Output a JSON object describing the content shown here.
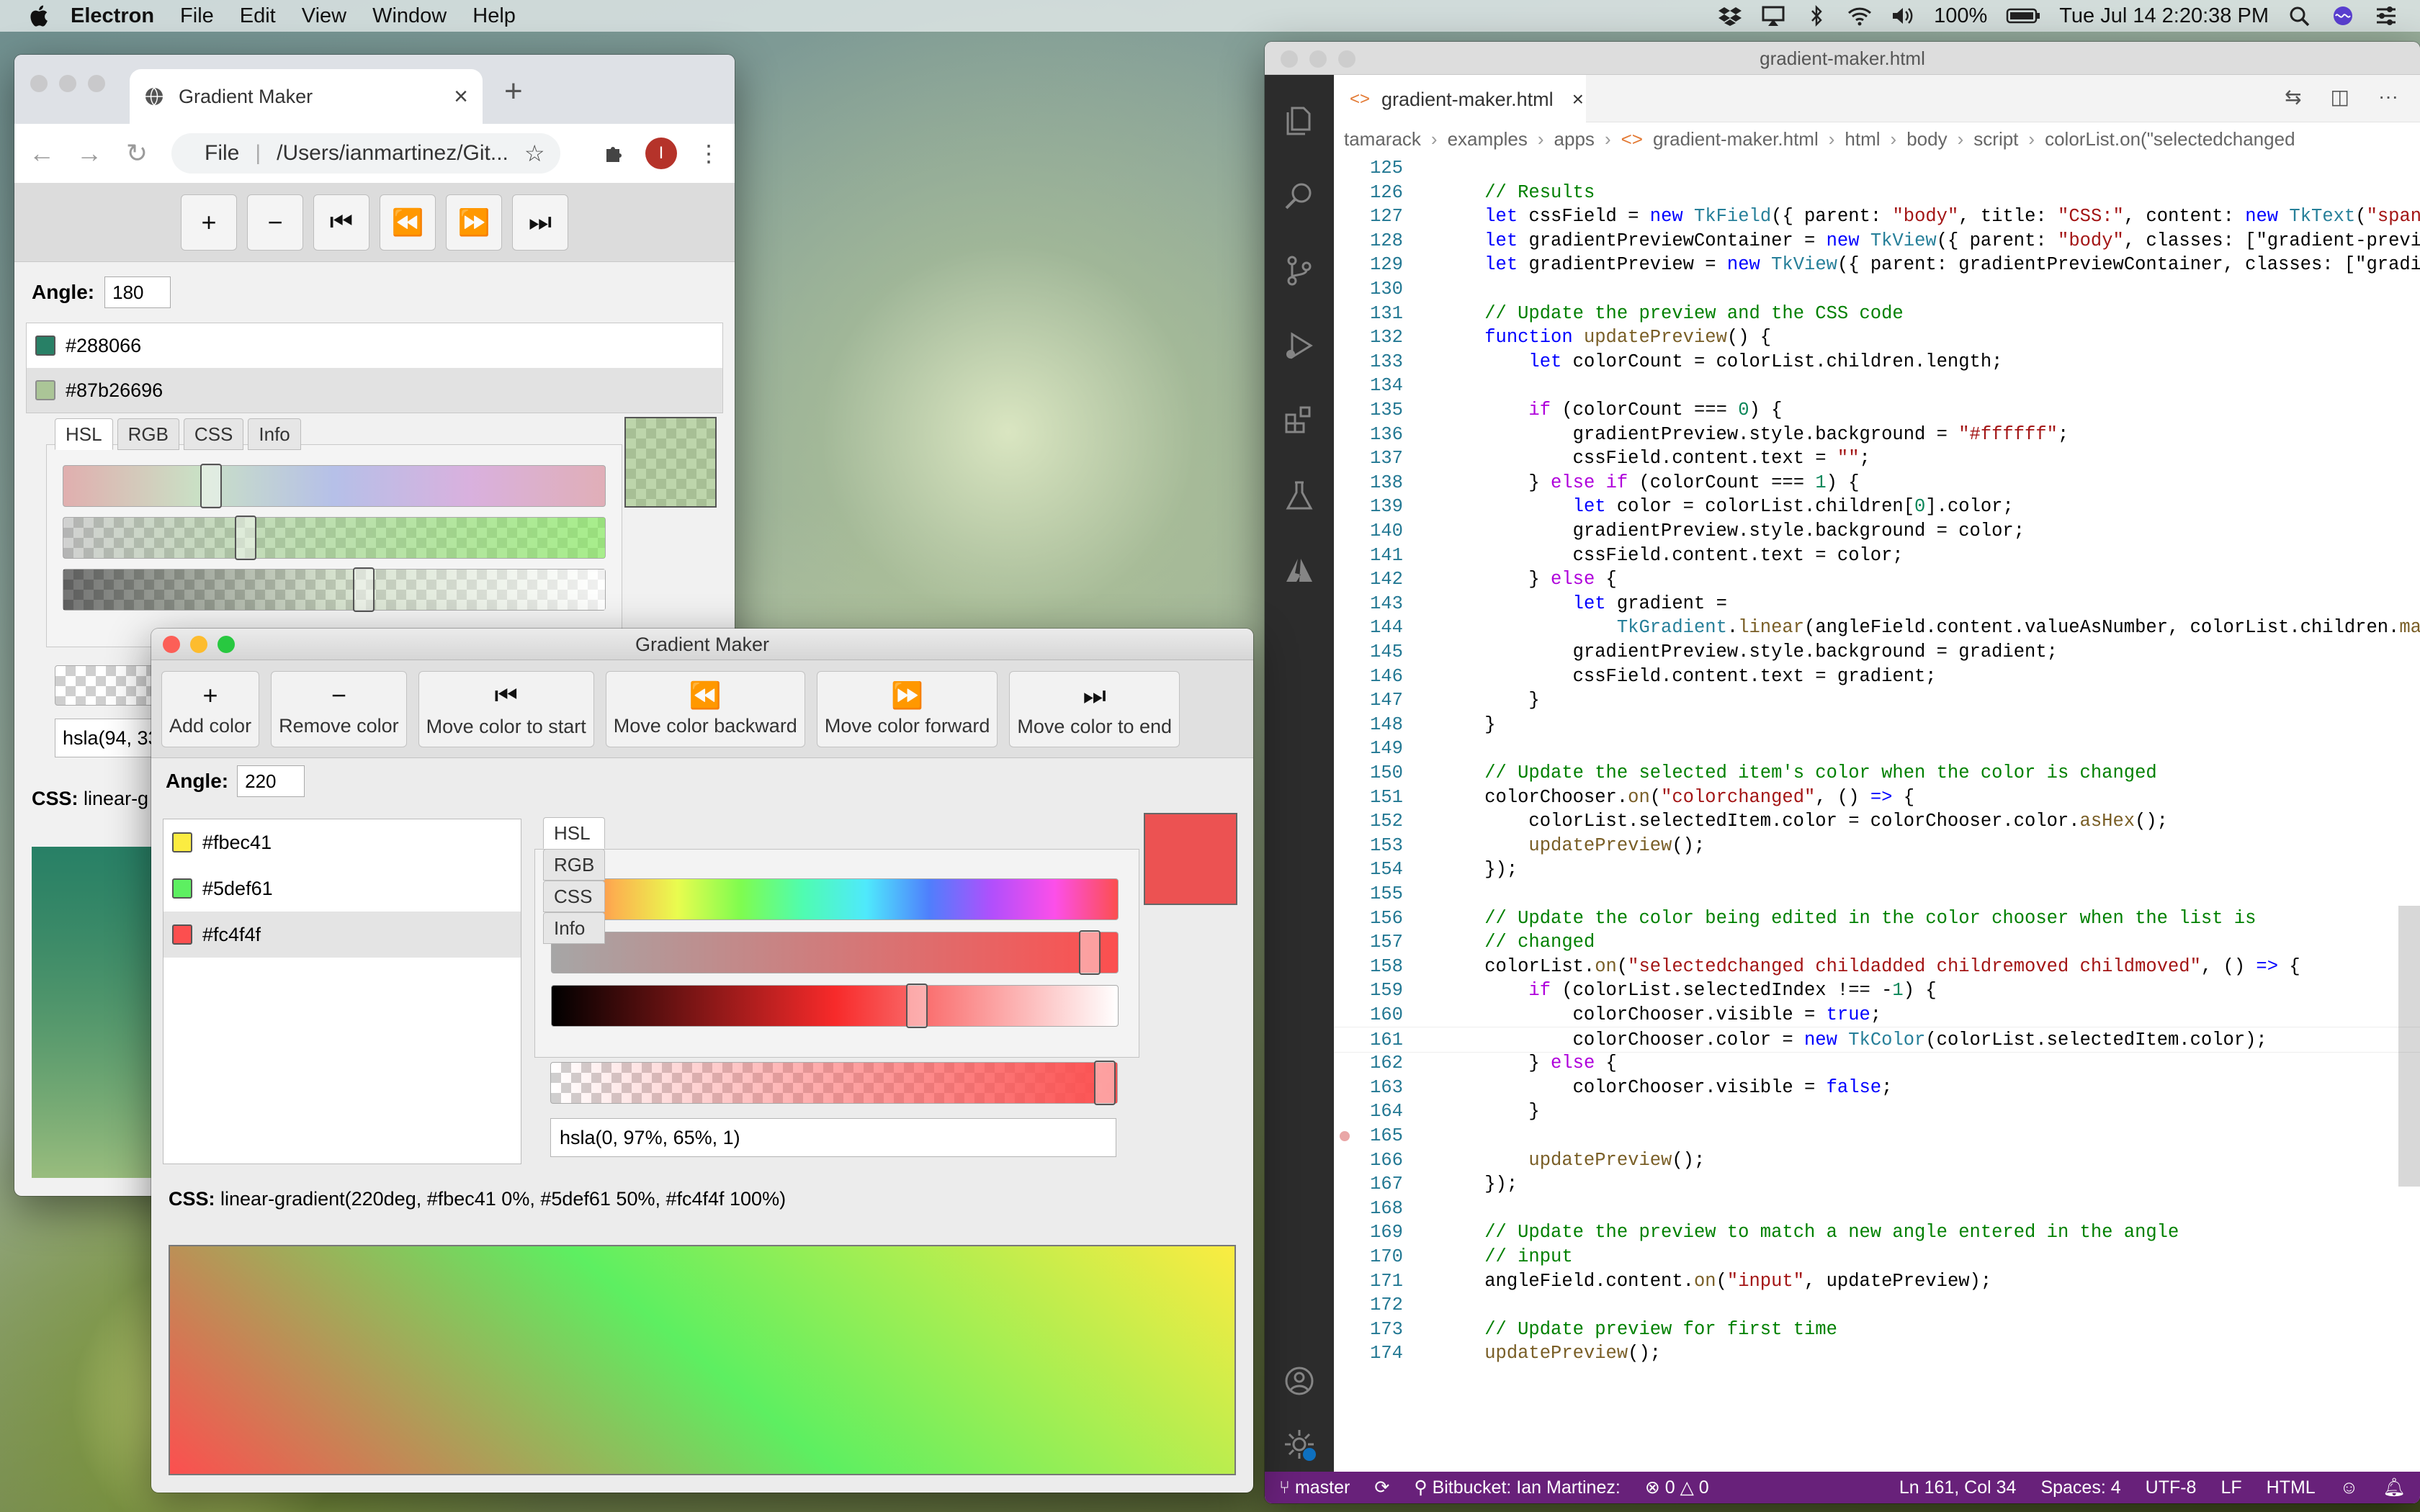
{
  "menubar": {
    "app": "Electron",
    "items": [
      "File",
      "Edit",
      "View",
      "Window",
      "Help"
    ],
    "battery": "100%",
    "clock": "Tue Jul 14  2:20:38 PM"
  },
  "chrome": {
    "tab_title": "Gradient Maker",
    "url_scheme": "File",
    "url_path": "/Users/ianmartinez/Git...",
    "avatar_letter": "I",
    "angle_label": "Angle:",
    "angle_value": "180",
    "colors": [
      {
        "hex": "#288066",
        "label": "#288066"
      },
      {
        "hex": "#87b266",
        "label": "#87b26696"
      }
    ],
    "tabs": [
      "HSL",
      "RGB",
      "CSS",
      "Info"
    ],
    "value_partial": "hsla(94, 33",
    "css_label": "CSS:",
    "css_partial": "linear-g"
  },
  "tk": {
    "window_title": "Gradient Maker",
    "toolbar": [
      {
        "label": "Add color",
        "icon": "plus-icon",
        "glyph": "+"
      },
      {
        "label": "Remove color",
        "icon": "minus-icon",
        "glyph": "−"
      },
      {
        "label": "Move color to start",
        "icon": "skip-start-icon",
        "glyph": "⏮"
      },
      {
        "label": "Move color backward",
        "icon": "rewind-icon",
        "glyph": "⏪"
      },
      {
        "label": "Move color forward",
        "icon": "fast-forward-icon",
        "glyph": "⏩"
      },
      {
        "label": "Move color to end",
        "icon": "skip-end-icon",
        "glyph": "⏭"
      }
    ],
    "angle_label": "Angle:",
    "angle_value": "220",
    "colors": [
      {
        "hex": "#fbec41",
        "label": "#fbec41"
      },
      {
        "hex": "#5def61",
        "label": "#5def61"
      },
      {
        "hex": "#fc4f4f",
        "label": "#fc4f4f"
      }
    ],
    "selected_index": 2,
    "tabs": [
      "HSL",
      "RGB",
      "CSS",
      "Info"
    ],
    "hsl": {
      "hue": 0,
      "saturation": 0.97,
      "lightness": 0.65,
      "alpha": 1
    },
    "value": "hsla(0, 97%, 65%, 1)",
    "css_label": "CSS:",
    "css_value": "linear-gradient(220deg, #fbec41 0%, #5def61 50%, #fc4f4f 100%)"
  },
  "vscode": {
    "window_title": "gradient-maker.html",
    "tab_label": "gradient-maker.html",
    "breadcrumbs": [
      "tamarack",
      "examples",
      "apps",
      "gradient-maker.html",
      "html",
      "body",
      "script",
      "colorList.on(\"selectedchanged"
    ],
    "status": {
      "branch": "master",
      "remote": "Bitbucket: Ian Martinez:",
      "problems": "0",
      "warnings": "0",
      "position": "Ln 161, Col 34",
      "spaces": "Spaces: 4",
      "encoding": "UTF-8",
      "eol": "LF",
      "language": "HTML"
    },
    "lines": [
      {
        "n": "125",
        "t": ""
      },
      {
        "n": "126",
        "t": "    // Results"
      },
      {
        "n": "127",
        "t": "    let cssField = new TkField({ parent: \"body\", title: \"CSS:\", content: new TkText(\"span\") })"
      },
      {
        "n": "128",
        "t": "    let gradientPreviewContainer = new TkView({ parent: \"body\", classes: [\"gradient-preview-co"
      },
      {
        "n": "129",
        "t": "    let gradientPreview = new TkView({ parent: gradientPreviewContainer, classes: [\"gradient-p"
      },
      {
        "n": "130",
        "t": ""
      },
      {
        "n": "131",
        "t": "    // Update the preview and the CSS code"
      },
      {
        "n": "132",
        "t": "    function updatePreview() {"
      },
      {
        "n": "133",
        "t": "        let colorCount = colorList.children.length;"
      },
      {
        "n": "134",
        "t": ""
      },
      {
        "n": "135",
        "t": "        if (colorCount === 0) {"
      },
      {
        "n": "136",
        "t": "            gradientPreview.style.background = \"#ffffff\";"
      },
      {
        "n": "137",
        "t": "            cssField.content.text = \"\";"
      },
      {
        "n": "138",
        "t": "        } else if (colorCount === 1) {"
      },
      {
        "n": "139",
        "t": "            let color = colorList.children[0].color;"
      },
      {
        "n": "140",
        "t": "            gradientPreview.style.background = color;"
      },
      {
        "n": "141",
        "t": "            cssField.content.text = color;"
      },
      {
        "n": "142",
        "t": "        } else {"
      },
      {
        "n": "143",
        "t": "            let gradient ="
      },
      {
        "n": "144",
        "t": "                TkGradient.linear(angleField.content.valueAsNumber, colorList.children.map((i"
      },
      {
        "n": "145",
        "t": "            gradientPreview.style.background = gradient;"
      },
      {
        "n": "146",
        "t": "            cssField.content.text = gradient;"
      },
      {
        "n": "147",
        "t": "        }"
      },
      {
        "n": "148",
        "t": "    }"
      },
      {
        "n": "149",
        "t": ""
      },
      {
        "n": "150",
        "t": "    // Update the selected item's color when the color is changed"
      },
      {
        "n": "151",
        "t": "    colorChooser.on(\"colorchanged\", () => {"
      },
      {
        "n": "152",
        "t": "        colorList.selectedItem.color = colorChooser.color.asHex();"
      },
      {
        "n": "153",
        "t": "        updatePreview();"
      },
      {
        "n": "154",
        "t": "    });"
      },
      {
        "n": "155",
        "t": ""
      },
      {
        "n": "156",
        "t": "    // Update the color being edited in the color chooser when the list is"
      },
      {
        "n": "157",
        "t": "    // changed"
      },
      {
        "n": "158",
        "t": "    colorList.on(\"selectedchanged childadded childremoved childmoved\", () => {"
      },
      {
        "n": "159",
        "t": "        if (colorList.selectedIndex !== -1) {"
      },
      {
        "n": "160",
        "t": "            colorChooser.visible = true;"
      },
      {
        "n": "161",
        "t": "            colorChooser.color = new TkColor(colorList.selectedItem.color);"
      },
      {
        "n": "162",
        "t": "        } else {"
      },
      {
        "n": "163",
        "t": "            colorChooser.visible = false;"
      },
      {
        "n": "164",
        "t": "        }"
      },
      {
        "n": "165",
        "t": ""
      },
      {
        "n": "166",
        "t": "        updatePreview();"
      },
      {
        "n": "167",
        "t": "    });"
      },
      {
        "n": "168",
        "t": ""
      },
      {
        "n": "169",
        "t": "    // Update the preview to match a new angle entered in the angle"
      },
      {
        "n": "170",
        "t": "    // input"
      },
      {
        "n": "171",
        "t": "    angleField.content.on(\"input\", updatePreview);"
      },
      {
        "n": "172",
        "t": ""
      },
      {
        "n": "173",
        "t": "    // Update preview for first time"
      },
      {
        "n": "174",
        "t": "    updatePreview();"
      }
    ]
  }
}
